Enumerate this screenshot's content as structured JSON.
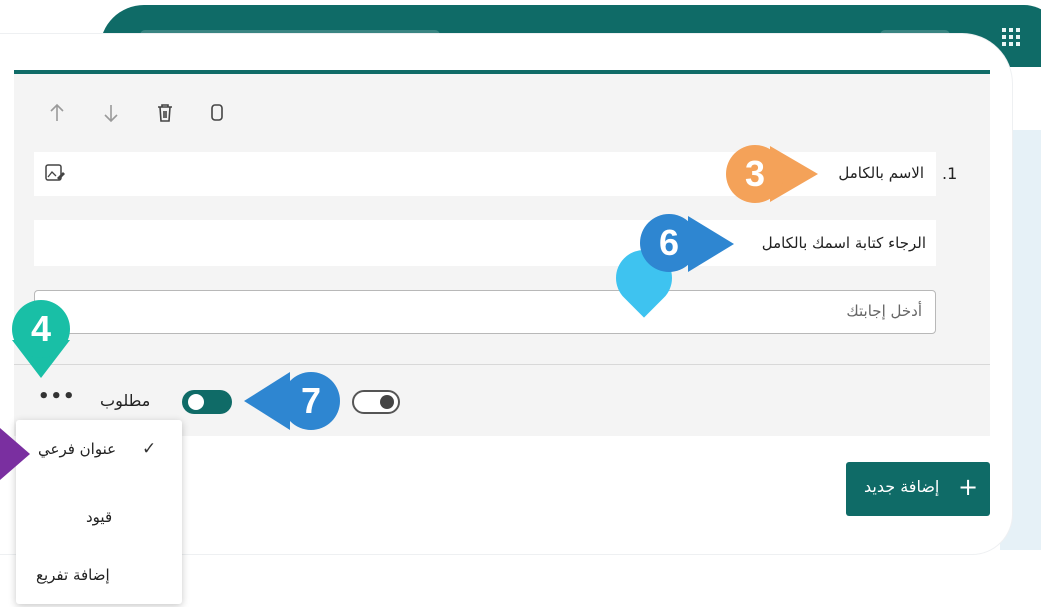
{
  "app": {
    "menu_icon": "waffle-icon"
  },
  "toolbar": {
    "move_up_icon": "arrow-up-icon",
    "move_down_icon": "arrow-down-icon",
    "delete_icon": "trash-icon",
    "copy_icon": "copy-icon"
  },
  "question": {
    "number": "1.",
    "title": "الاسم بالكامل",
    "subtitle": "الرجاء كتابة اسمك بالكامل",
    "answer_placeholder": "أدخل إجابتك",
    "required_label": "مطلوب",
    "required_on": true,
    "more_label": "•••"
  },
  "menu": {
    "items": [
      {
        "label": "عنوان فرعي",
        "checked": true,
        "check_glyph": "✓"
      },
      {
        "label": "قيود",
        "checked": false
      },
      {
        "label": "إضافة تفريع",
        "checked": false
      }
    ]
  },
  "add_button": {
    "label": "إضافة جديد",
    "plus": "+"
  },
  "callouts": [
    {
      "label": "3",
      "color": "#f4a259"
    },
    {
      "label": "6",
      "color": "#2e86d1"
    },
    {
      "label": "4",
      "color": "#19bfa6"
    },
    {
      "label": "7",
      "color": "#2e86d1"
    }
  ],
  "colors": {
    "accent": "#0f6b67",
    "callout_cyan": "#3ec3f0",
    "callout_purple": "#7a2fa0"
  }
}
